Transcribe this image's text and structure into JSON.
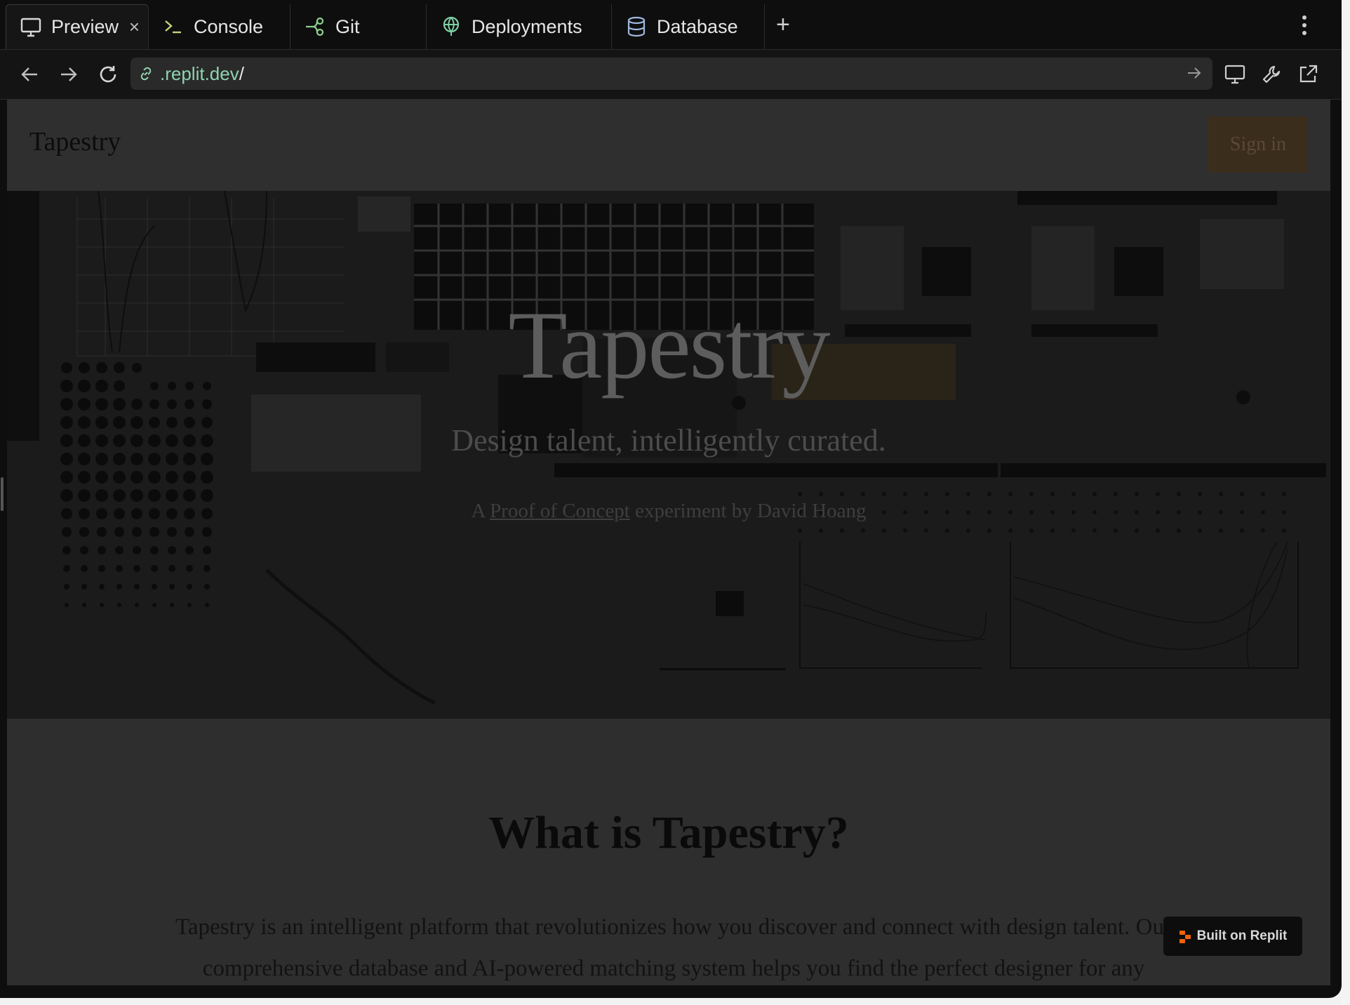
{
  "tabs": [
    {
      "label": "Preview",
      "icon": "monitor-icon",
      "active": true
    },
    {
      "label": "Console",
      "icon": "terminal-icon"
    },
    {
      "label": "Git",
      "icon": "git-branch-icon"
    },
    {
      "label": "Deployments",
      "icon": "globe-icon"
    },
    {
      "label": "Database",
      "icon": "database-icon"
    }
  ],
  "tab_close": "×",
  "new_tab": "+",
  "url": {
    "host": ".replit.dev",
    "path": "/"
  },
  "site": {
    "brand": "Tapestry",
    "signin": "Sign in",
    "hero_title": "Tapestry",
    "hero_subtitle": "Design talent, intelligently curated.",
    "hero_prefix": "A ",
    "hero_link": "Proof of Concept",
    "hero_suffix": " experiment by David Hoang",
    "about_heading": "What is Tapestry?",
    "about_text": "Tapestry is an intelligent platform that revolutionizes how you discover and connect with design talent. Our comprehensive database and AI-powered matching system helps you find the perfect designer for any"
  },
  "badge": "Built on Replit",
  "colors": {
    "accent_green": "#8fd3b0",
    "signin_bg": "#3b2d1c",
    "replit_orange": "#f26207"
  }
}
